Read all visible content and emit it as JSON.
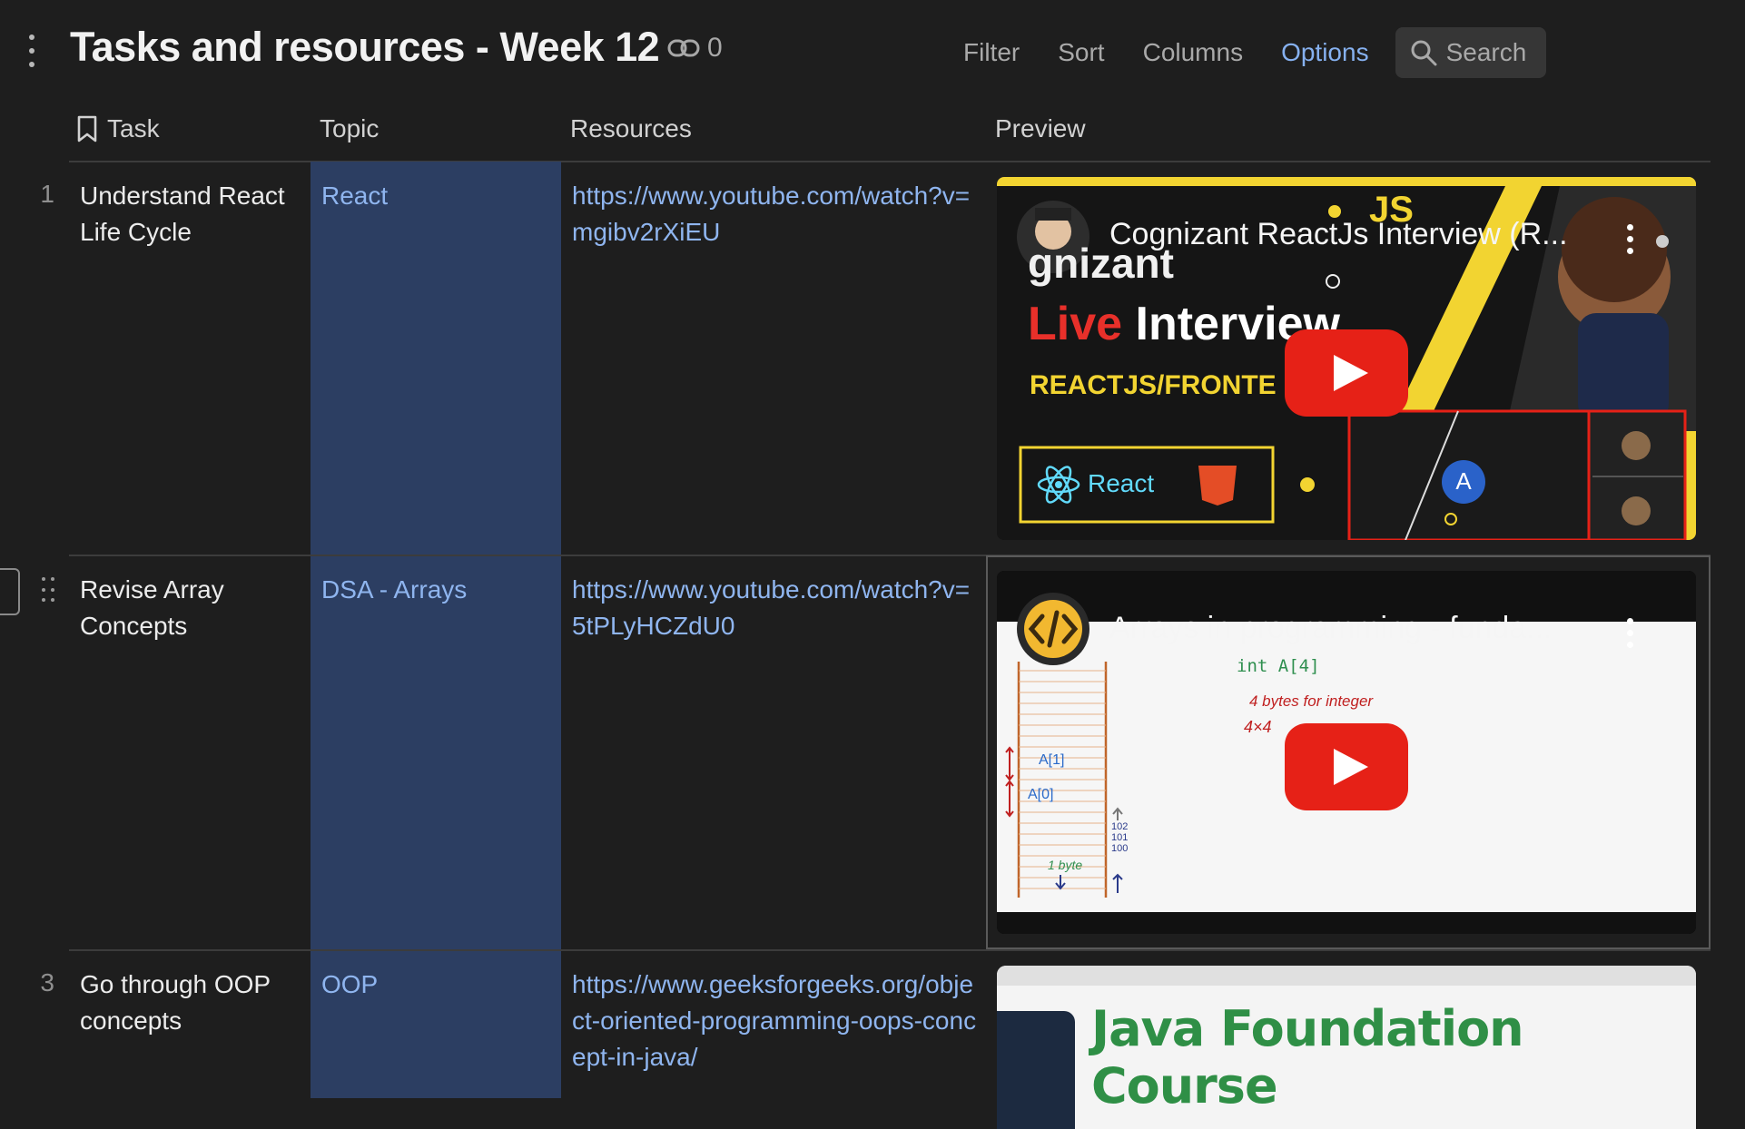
{
  "header": {
    "title": "Tasks and resources - Week 12",
    "link_count": "0",
    "toolbar": {
      "filter": "Filter",
      "sort": "Sort",
      "columns": "Columns",
      "options": "Options",
      "search": "Search"
    }
  },
  "columns": {
    "task": "Task",
    "topic": "Topic",
    "resources": "Resources",
    "preview": "Preview"
  },
  "rows": [
    {
      "num": "1",
      "task": "Understand React Life Cycle",
      "topic": "React",
      "resource": "https://www.youtube.com/watch?v=mgibv2rXiEU",
      "preview": {
        "title": "Cognizant ReactJs Interview (R...",
        "overlay_brand": "gnizant",
        "overlay_live": "Live",
        "overlay_interview": "Interview",
        "overlay_sub": "REACTJS/FRONTE",
        "overlay_react": "React",
        "overlay_js": "JS",
        "overlay_avatar": "A"
      }
    },
    {
      "num": "",
      "task": "Revise Array Concepts",
      "topic": "DSA - Arrays",
      "resource": "https://www.youtube.com/watch?v=5tPLyHCZdU0",
      "preview": {
        "title": "Arrays in programming - funda...",
        "note1": "int  A[4]",
        "note2": "4 bytes for integer",
        "note3": "4×4",
        "cell1": "A[1]",
        "cell0": "A[0]",
        "addr": "102 101 100",
        "byte": "1 byte"
      }
    },
    {
      "num": "3",
      "task": "Go through OOP concepts",
      "topic": "OOP",
      "resource": "https://www.geeksforgeeks.org/object-oriented-programming-oops-concept-in-java/",
      "preview": {
        "title": "Java Foundation Course"
      }
    }
  ]
}
